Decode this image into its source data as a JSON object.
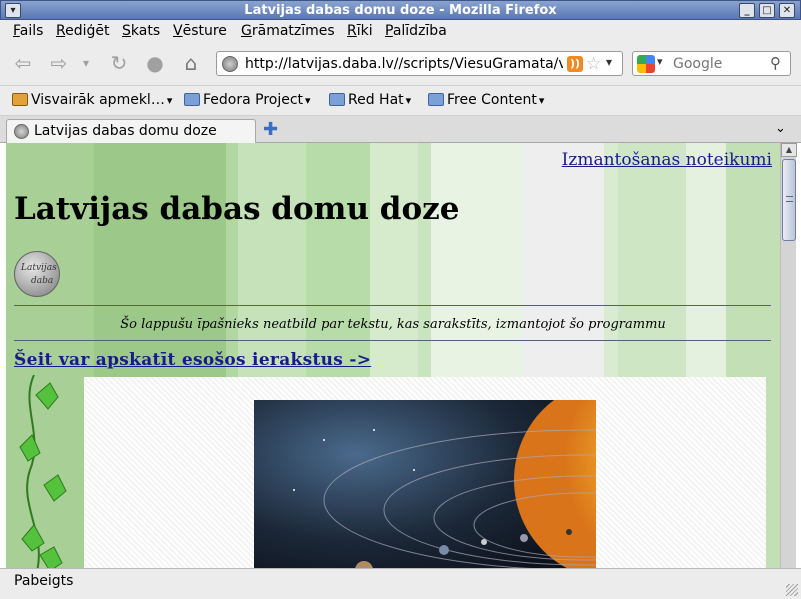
{
  "window": {
    "title": "Latvijas dabas domu doze - Mozilla Firefox"
  },
  "menubar": {
    "items": [
      "Fails",
      "Rediģēt",
      "Skats",
      "Vēsture",
      "Grāmatzīmes",
      "Rīki",
      "Palīdzība"
    ]
  },
  "navbar": {
    "url": "http://latvijas.daba.lv//scripts/ViesuGramata/vg.",
    "search_placeholder": "Google"
  },
  "bookmarks": {
    "items": [
      "Visvairāk apmekl…",
      "Fedora Project",
      "Red Hat",
      "Free Content"
    ]
  },
  "tabs": {
    "items": [
      "Latvijas dabas domu doze"
    ]
  },
  "page": {
    "terms_link": "Izmantošanas noteikumi",
    "heading": "Latvijas dabas domu doze",
    "logo_text_1": "Latvijas",
    "logo_text_2": "daba",
    "disclaimer": "Šo lappušu īpašnieks neatbild par tekstu, kas sarakstīts, izmantojot šo programmu",
    "entries_link": "Šeit var apskatīt esošos ierakstus ->"
  },
  "statusbar": {
    "text": "Pabeigts"
  }
}
